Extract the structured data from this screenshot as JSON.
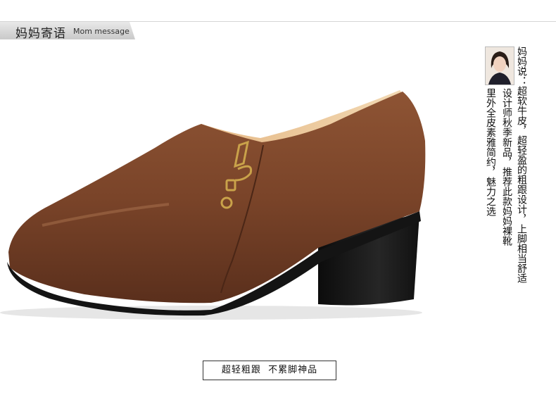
{
  "header": {
    "title_cn": "妈妈寄语",
    "title_en": "Mom message"
  },
  "mom_message": {
    "lines": [
      "妈妈说：超软牛皮，超轻盈的粗跟设计，上脚相当舒适",
      "设计师秋季新品，推荐此款妈妈裸靴",
      "里外全皮素雅简约，魅力之选"
    ]
  },
  "caption": "超轻粗跟  不累脚神品",
  "colors": {
    "leather": "#7a4429",
    "sole": "#151515",
    "lining": "#e8c497",
    "zipper_pull": "#c9a24a"
  }
}
